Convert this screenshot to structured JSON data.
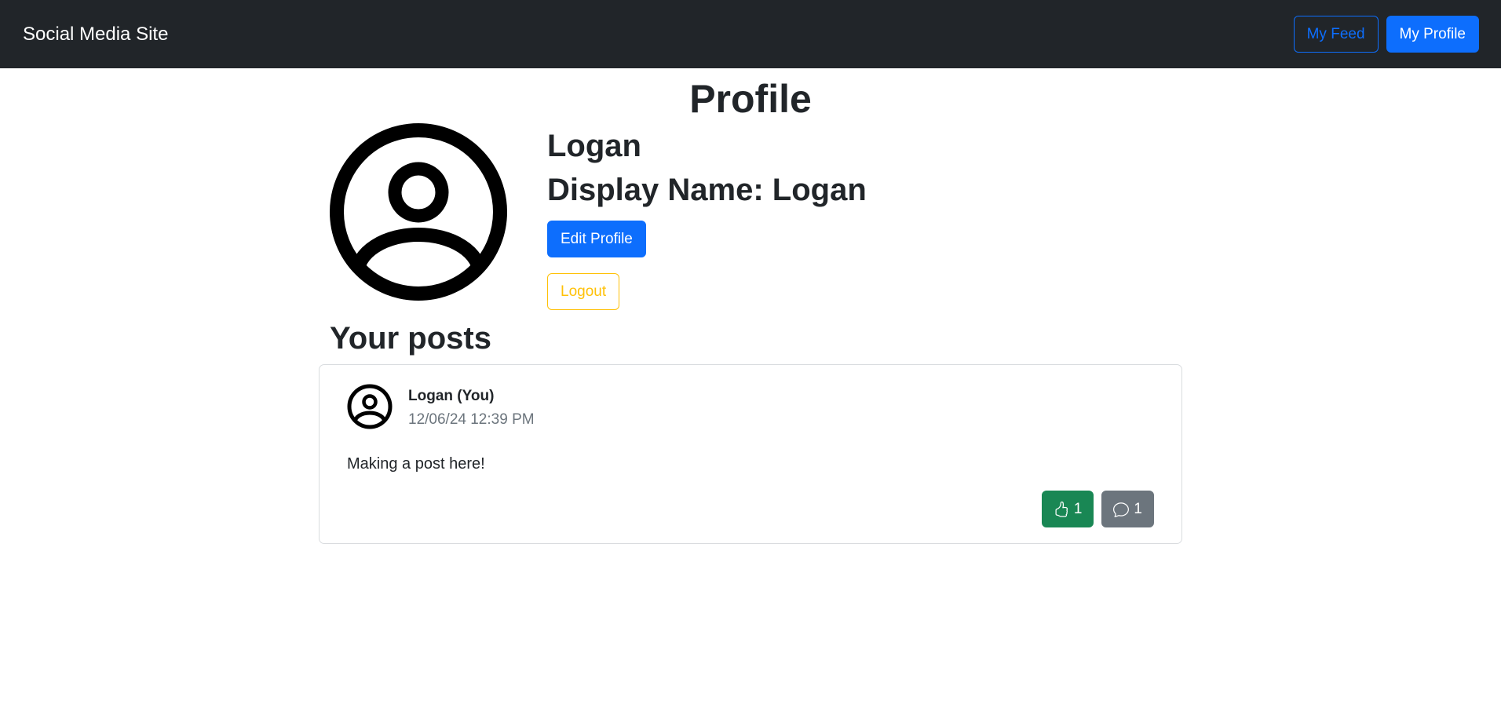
{
  "navbar": {
    "brand": "Social Media Site",
    "my_feed_label": "My Feed",
    "my_profile_label": "My Profile"
  },
  "page": {
    "title": "Profile"
  },
  "profile": {
    "username": "Logan",
    "display_name": "Display Name: Logan",
    "edit_label": "Edit Profile",
    "logout_label": "Logout",
    "avatar_icon": "user-circle-icon"
  },
  "posts": {
    "heading": "Your posts",
    "items": [
      {
        "author": "Logan (You)",
        "timestamp": "12/06/24 12:39 PM",
        "body": "Making a post here!",
        "likes": "1",
        "comments": "1",
        "like_icon": "thumbs-up-icon",
        "comment_icon": "comment-icon"
      }
    ]
  },
  "colors": {
    "navbar_bg": "#212529",
    "primary": "#0d6efd",
    "warning": "#ffc107",
    "success": "#198754",
    "secondary": "#6c757d"
  }
}
